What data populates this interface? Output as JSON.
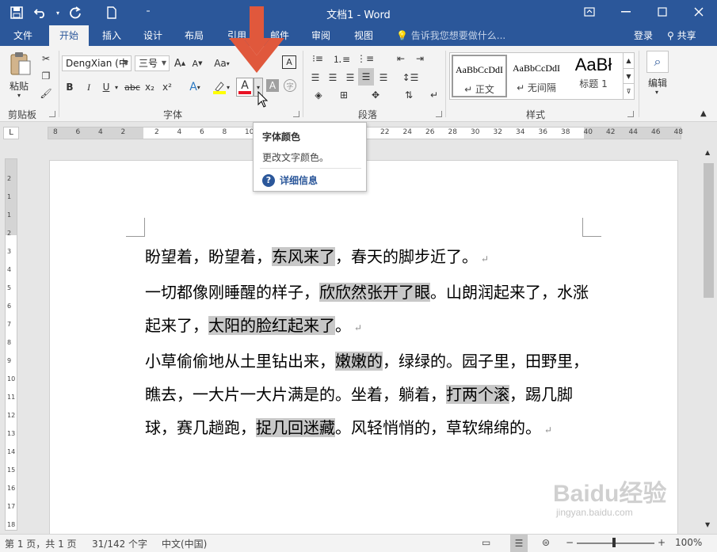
{
  "titlebar": {
    "doc_title": "文档1 - Word",
    "qat": {
      "save_icon": "save-icon",
      "undo_icon": "undo-icon",
      "redo_icon": "redo-icon",
      "new_icon": "new-doc-icon",
      "customize_icon": "customize-icon"
    },
    "window": {
      "restore_ribbon": "▣",
      "minimize": "—",
      "maximize": "☐",
      "close": "✕"
    }
  },
  "tabs": [
    {
      "label": "文件"
    },
    {
      "label": "开始"
    },
    {
      "label": "插入"
    },
    {
      "label": "设计"
    },
    {
      "label": "布局"
    },
    {
      "label": "引用"
    },
    {
      "label": "邮件"
    },
    {
      "label": "审阅"
    },
    {
      "label": "视图"
    }
  ],
  "tellme": "告诉我您想要做什么...",
  "login": "登录",
  "share": "共享",
  "ribbon": {
    "clipboard": {
      "label": "剪贴板",
      "paste": "粘贴"
    },
    "font": {
      "label": "字体",
      "font_name": "DengXian (中",
      "font_size": "三号",
      "grow": "A",
      "shrink": "A",
      "case": "Aa",
      "clear": "A",
      "phonetic": "A",
      "bold": "B",
      "italic": "I",
      "underline": "U",
      "strike": "abc",
      "sub": "x₂",
      "sup": "x²",
      "effects": "A",
      "font_color": "A",
      "shading": "A",
      "encircle": "字"
    },
    "paragraph": {
      "label": "段落"
    },
    "styles": {
      "label": "样式",
      "items": [
        {
          "preview": "AaBbCcDdI",
          "name": "↵ 正文"
        },
        {
          "preview": "AaBbCcDdI",
          "name": "↵ 无间隔"
        },
        {
          "preview": "AaBł",
          "name": "标题 1"
        }
      ]
    },
    "editing": {
      "label": "编辑"
    }
  },
  "tooltip": {
    "title": "字体颜色",
    "description": "更改文字颜色。",
    "help": "详细信息"
  },
  "document": {
    "paragraphs": [
      [
        {
          "t": "盼望着，盼望着，"
        },
        {
          "t": "东风来了",
          "hl": true
        },
        {
          "t": "，春天的脚步近了。"
        }
      ],
      [
        {
          "t": "一切都像刚睡醒的样子，"
        },
        {
          "t": "欣欣然张开了眼",
          "hl": true
        },
        {
          "t": "。山朗润起来了，水涨起来了，"
        },
        {
          "t": "太阳的脸红起来了",
          "hl": true
        },
        {
          "t": "。"
        }
      ],
      [
        {
          "t": "小草偷偷地从土里钻出来，"
        },
        {
          "t": "嫩嫩的",
          "hl": true
        },
        {
          "t": "，绿绿的。园子里，田野里，瞧去，一大片一大片满是的。坐着，躺着，"
        },
        {
          "t": "打两个滚",
          "hl": true
        },
        {
          "t": "，踢几脚球，赛几趟跑，"
        },
        {
          "t": "捉几回迷藏",
          "hl": true
        },
        {
          "t": "。风轻悄悄的，草软绵绵的。"
        }
      ]
    ],
    "para_mark": "↵"
  },
  "ruler": {
    "h_ticks": [
      "8",
      "6",
      "4",
      "2",
      "2",
      "4",
      "6",
      "8",
      "10",
      "12",
      "14",
      "16",
      "18",
      "20",
      "22",
      "24",
      "26",
      "28",
      "30",
      "32",
      "34",
      "36",
      "38",
      "40",
      "42",
      "44",
      "46",
      "48"
    ],
    "v_ticks": [
      "2",
      "1",
      "1",
      "2",
      "3",
      "4",
      "5",
      "6",
      "7",
      "8",
      "9",
      "10",
      "11",
      "12",
      "13",
      "14",
      "15",
      "16",
      "17",
      "18"
    ]
  },
  "status": {
    "page": "第 1 页，共 1 页",
    "words": "31/142 个字",
    "lang": "中文(中国)",
    "zoom": "100%"
  },
  "watermark": {
    "logo": "Baidu经验",
    "sub": "jingyan.baidu.com"
  },
  "colors": {
    "brand": "#2b579a",
    "font_color_bar": "#e81123",
    "arrow": "#e0583c"
  }
}
